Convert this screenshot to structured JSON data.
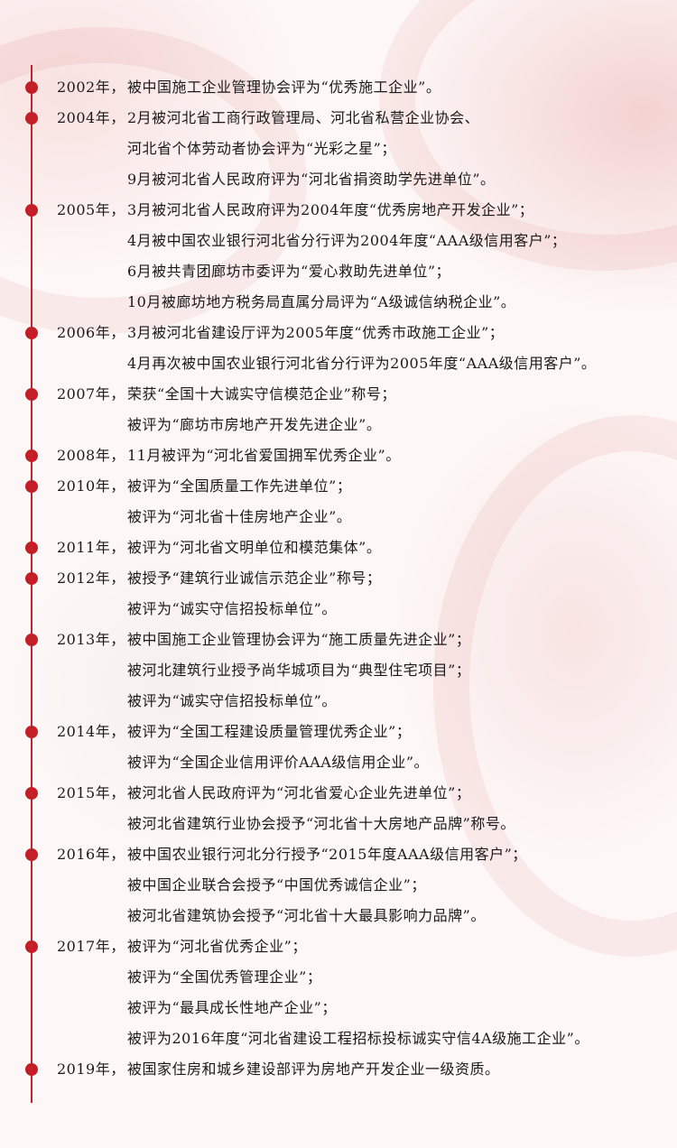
{
  "entries": [
    {
      "year": "2002年，",
      "lines": [
        "被中国施工企业管理协会评为“优秀施工企业”。"
      ]
    },
    {
      "year": "2004年，",
      "lines": [
        "2月被河北省工商行政管理局、河北省私营企业协会、",
        "河北省个体劳动者协会评为“光彩之星”；",
        "9月被河北省人民政府评为“河北省捐资助学先进单位”。"
      ]
    },
    {
      "year": "2005年，",
      "lines": [
        "3月被河北省人民政府评为2004年度“优秀房地产开发企业”；",
        "4月被中国农业银行河北省分行评为2004年度“AAA级信用客户”；",
        "6月被共青团廊坊市委评为“爱心救助先进单位”；",
        "10月被廊坊地方税务局直属分局评为“A级诚信纳税企业”。"
      ]
    },
    {
      "year": "2006年，",
      "lines": [
        "3月被河北省建设厅评为2005年度“优秀市政施工企业”；",
        "4月再次被中国农业银行河北省分行评为2005年度“AAA级信用客户”。"
      ]
    },
    {
      "year": "2007年，",
      "lines": [
        "荣获“全国十大诚实守信模范企业”称号；",
        "被评为“廊坊市房地产开发先进企业”。"
      ]
    },
    {
      "year": "2008年，",
      "lines": [
        "11月被评为“河北省爱国拥军优秀企业”。"
      ]
    },
    {
      "year": "2010年，",
      "lines": [
        "被评为“全国质量工作先进单位”；",
        "被评为“河北省十佳房地产企业”。"
      ]
    },
    {
      "year": "2011年，",
      "lines": [
        "被评为“河北省文明单位和模范集体”。"
      ]
    },
    {
      "year": "2012年，",
      "lines": [
        "被授予“建筑行业诚信示范企业”称号；",
        "被评为“诚实守信招投标单位”。"
      ]
    },
    {
      "year": "2013年，",
      "lines": [
        "被中国施工企业管理协会评为“施工质量先进企业”；",
        "被河北建筑行业授予尚华城项目为“典型住宅项目”；",
        "被评为“诚实守信招投标单位”。"
      ]
    },
    {
      "year": "2014年，",
      "lines": [
        "被评为“全国工程建设质量管理优秀企业”；",
        "被评为“全国企业信用评价AAA级信用企业”。"
      ]
    },
    {
      "year": "2015年，",
      "lines": [
        "被河北省人民政府评为“河北省爱心企业先进单位”；",
        "被河北省建筑行业协会授予“河北省十大房地产品牌”称号。"
      ]
    },
    {
      "year": "2016年，",
      "lines": [
        "被中国农业银行河北分行授予“2015年度AAA级信用客户”；",
        "被中国企业联合会授予“中国优秀诚信企业”；",
        "被河北省建筑协会授予“河北省十大最具影响力品牌”。"
      ]
    },
    {
      "year": "2017年，",
      "lines": [
        "被评为“河北省优秀企业”；",
        "被评为“全国优秀管理企业”；",
        "被评为“最具成长性地产企业”；",
        "被评为2016年度“河北省建设工程招标投标诚实守信4A级施工企业”。"
      ]
    },
    {
      "year": "2019年，",
      "lines": [
        "被国家住房和城乡建设部评为房地产开发企业一级资质。"
      ]
    }
  ]
}
